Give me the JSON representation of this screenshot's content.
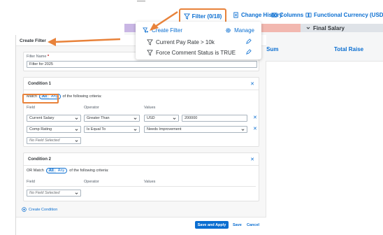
{
  "toolbar": {
    "filter_label": "Filter (0/18)",
    "change_history_label": "Change History",
    "columns_label": "Columns",
    "functional_currency_label": "Functional Currency (USD)"
  },
  "table_bg": {
    "final_salary_header": "Final Salary",
    "history_fragment": "tory",
    "sum_fragment": "p Sum",
    "total_raise": "Total Raise"
  },
  "popover": {
    "create_filter": "Create Filter",
    "manage": "Manage",
    "filters": [
      "Current Pay Rate > 10k",
      "Force Comment Status is TRUE"
    ]
  },
  "panel": {
    "title": "Create Filter",
    "filter_name_label": "Filter Name",
    "required_marker": "*",
    "filter_name_value": "Filter for 2025",
    "condition1": {
      "title": "Condition 1",
      "match_prefix": "Match",
      "all": "All",
      "any": "Any",
      "match_suffix": "of the following criteria:",
      "col_field": "Field",
      "col_operator": "Operator",
      "col_values": "Values",
      "rows": [
        {
          "field": "Current Salary",
          "operator": "Greater Than",
          "currency": "USD",
          "value": "200000"
        },
        {
          "field": "Comp Rating",
          "operator": "Is Equal To",
          "value": "Needs Improvement"
        }
      ],
      "no_field": "No Field Selected"
    },
    "condition2": {
      "title": "Condition 2",
      "match_prefix": "OR Match",
      "all": "All",
      "any": "Any",
      "match_suffix": "of the following criteria:",
      "col_field": "Field",
      "col_operator": "Operator",
      "col_values": "Values",
      "no_field": "No Field Selected"
    },
    "create_condition": "Create Condition",
    "save_and_apply": "Save and Apply",
    "save": "Save",
    "cancel": "Cancel"
  },
  "colors": {
    "accent": "#0a6ed1",
    "highlight": "#e8823a"
  }
}
